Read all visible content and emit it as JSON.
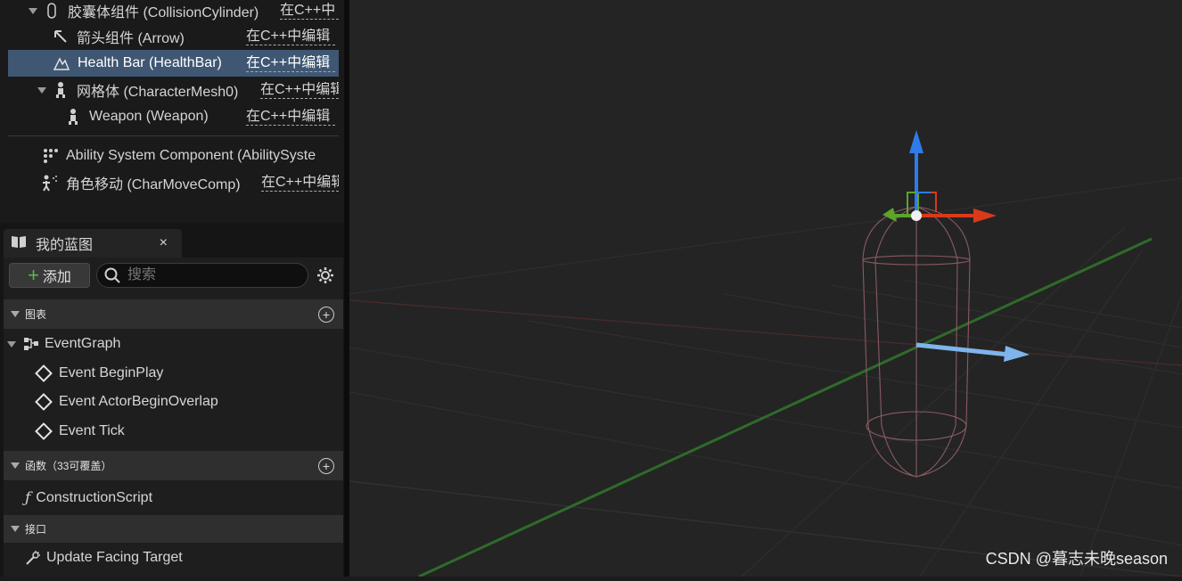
{
  "components": {
    "capsule": {
      "label": "胶囊体组件 (CollisionCylinder)",
      "edit": "在C++中"
    },
    "arrow": {
      "label": "箭头组件 (Arrow)",
      "edit": "在C++中编辑"
    },
    "healthbar": {
      "label": "Health Bar (HealthBar)",
      "edit": "在C++中编辑"
    },
    "mesh": {
      "label": "网格体 (CharacterMesh0)",
      "edit": "在C++中编辑"
    },
    "weapon": {
      "label": "Weapon (Weapon)",
      "edit": "在C++中编辑"
    },
    "ability": {
      "label": "Ability System Component (AbilitySyste"
    },
    "charmove": {
      "label": "角色移动 (CharMoveComp)",
      "edit": "在C++中编辑"
    }
  },
  "my_blueprint": {
    "tab_title": "我的蓝图",
    "close": "×",
    "add_label": "添加",
    "search_placeholder": "搜索",
    "sections": {
      "graphs": "图表",
      "functions": "函数（33可覆盖）",
      "interfaces": "接口"
    },
    "event_graph": "EventGraph",
    "events": [
      "Event BeginPlay",
      "Event ActorBeginOverlap",
      "Event Tick"
    ],
    "construction_script": "ConstructionScript",
    "interface_item": "Update Facing Target"
  },
  "watermark": "CSDN @暮志未晚season",
  "colors": {
    "selection": "#3f5773",
    "gizmo_z": "#2f7be8",
    "gizmo_x": "#d93a1a",
    "gizmo_y": "#5aa52a",
    "forward_arrow": "#7fb4ec",
    "capsule_wire": "#8a5a62"
  }
}
